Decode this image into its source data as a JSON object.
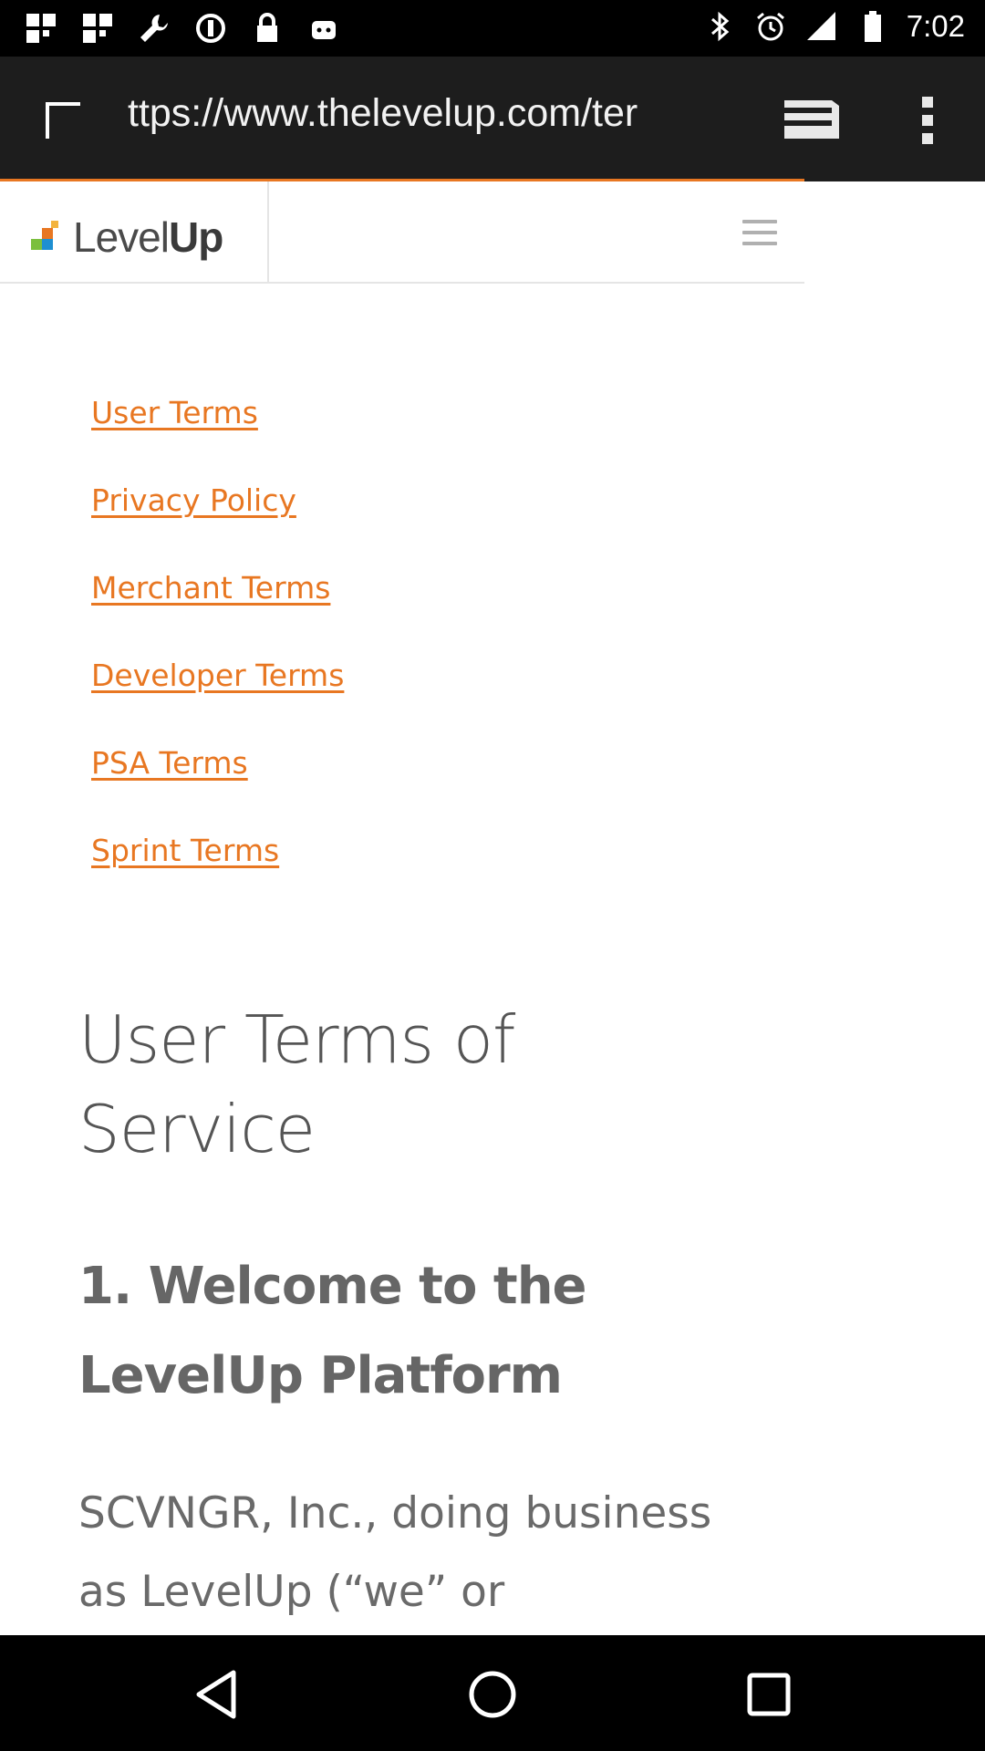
{
  "status_bar": {
    "time": "7:02",
    "left_icons": [
      "google-plus-icon",
      "google-plus-icon",
      "wrench-icon",
      "blocked-icon",
      "lock-icon",
      "android-icon"
    ],
    "right_icons": [
      "bluetooth-icon",
      "alarm-icon",
      "signal-icon",
      "battery-icon"
    ]
  },
  "browser": {
    "url": "ttps://www.thelevelup.com/ter",
    "progress_color": "#e87722"
  },
  "site": {
    "logo_text_light": "Level",
    "logo_text_bold": "Up"
  },
  "links": [
    {
      "label": "User Terms"
    },
    {
      "label": "Privacy Policy"
    },
    {
      "label": "Merchant Terms"
    },
    {
      "label": "Developer Terms"
    },
    {
      "label": "PSA Terms"
    },
    {
      "label": "Sprint Terms"
    }
  ],
  "content": {
    "title": "User Terms of Service",
    "section_title": "1. Welcome to the LevelUp Platform",
    "body": "SCVNGR, Inc., doing business as LevelUp (“we” or"
  },
  "colors": {
    "accent": "#e87722",
    "toolbar_bg": "#1d1d1d"
  }
}
